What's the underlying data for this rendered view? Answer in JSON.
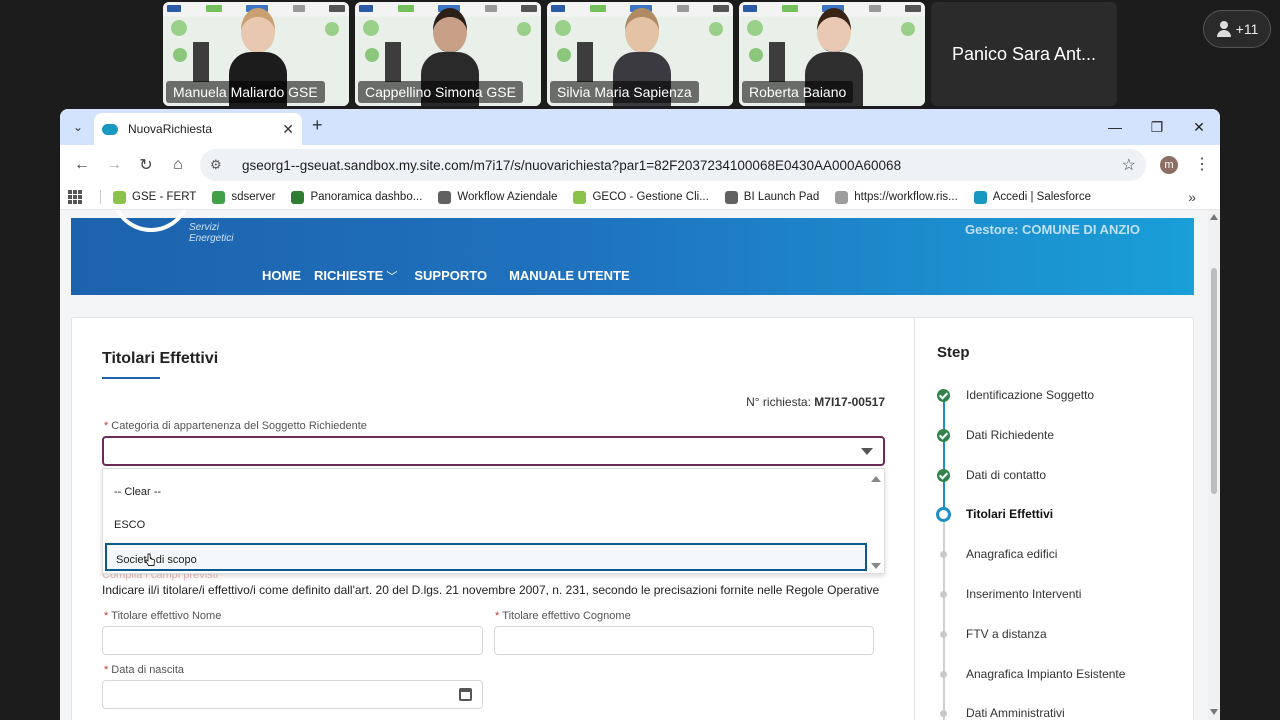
{
  "meeting": {
    "participants": [
      {
        "name": "Manuela Maliardo GSE",
        "skin": "#e8c8b0",
        "hair": "#c9a070",
        "clothes": "#1c1c1c"
      },
      {
        "name": "Cappellino Simona GSE",
        "skin": "#c8a088",
        "hair": "#2a2018",
        "clothes": "#2a2a2a"
      },
      {
        "name": "Silvia Maria Sapienza",
        "skin": "#e3c2a6",
        "hair": "#b08a62",
        "clothes": "#3a3a40"
      },
      {
        "name": "Roberta Baiano",
        "skin": "#e9c9b4",
        "hair": "#3a2418",
        "clothes": "#2f2f2f"
      }
    ],
    "plain_tile_name": "Panico Sara Ant...",
    "more_count": "+11"
  },
  "browser": {
    "tab_title": "NuovaRichiesta",
    "tab_close": "✕",
    "new_tab": "+",
    "url": "gseorg1--gseuat.sandbox.my.site.com/m7i17/s/nuovarichiesta?par1=82F2037234100068E0430AA000A60068",
    "profile_initial": "m",
    "bookmarks": [
      {
        "label": "GSE - FERT",
        "color": "#8bc34a"
      },
      {
        "label": "sdserver",
        "color": "#43a047"
      },
      {
        "label": "Panoramica dashbo...",
        "color": "#2e7d32"
      },
      {
        "label": "Workflow Aziendale",
        "color": "#616161"
      },
      {
        "label": "GECO - Gestione Cli...",
        "color": "#8bc34a"
      },
      {
        "label": "BI Launch Pad",
        "color": "#616161"
      },
      {
        "label": "https://workflow.ris...",
        "color": "#9e9e9e"
      },
      {
        "label": "Accedi | Salesforce",
        "color": "#1798c1"
      }
    ]
  },
  "site": {
    "logo_line1": "Servizi",
    "logo_line2": "Energetici",
    "gestore": "Gestore: COMUNE DI ANZIO",
    "nav": {
      "home": "HOME",
      "richieste": "RICHIESTE",
      "supporto": "SUPPORTO",
      "manuale": "MANUALE UTENTE"
    }
  },
  "form": {
    "title": "Titolari Effettivi",
    "request_label": "N° richiesta:",
    "request_number": "M7I17-00517",
    "category_label": "Categoria di appartenenza del Soggetto Richiedente",
    "category_options": [
      "-- Clear --",
      "ESCO",
      "Società di scopo"
    ],
    "hint_faded": "Compila i campi previsti",
    "description": "Indicare il/i titolare/i effettivo/i come definito dall'art. 20 del D.lgs. 21 novembre 2007, n. 231, secondo le precisazioni fornite nelle Regole Operative",
    "nome_label": "Titolare effettivo Nome",
    "cognome_label": "Titolare effettivo Cognome",
    "nascita_label": "Data di nascita"
  },
  "steps": {
    "title": "Step",
    "items": [
      {
        "label": "Identificazione Soggetto",
        "state": "done"
      },
      {
        "label": "Dati Richiedente",
        "state": "done"
      },
      {
        "label": "Dati di contatto",
        "state": "done"
      },
      {
        "label": "Titolari Effettivi",
        "state": "current"
      },
      {
        "label": "Anagrafica edifici",
        "state": "todo"
      },
      {
        "label": "Inserimento Interventi",
        "state": "todo"
      },
      {
        "label": "FTV a distanza",
        "state": "todo"
      },
      {
        "label": "Anagrafica Impianto Esistente",
        "state": "todo"
      },
      {
        "label": "Dati Amministrativi",
        "state": "todo"
      }
    ]
  },
  "colors": {
    "accent": "#1d62ad",
    "step_done": "#2e844a",
    "step_current": "#1d8fc6",
    "focus_border": "#6b2a5a"
  }
}
